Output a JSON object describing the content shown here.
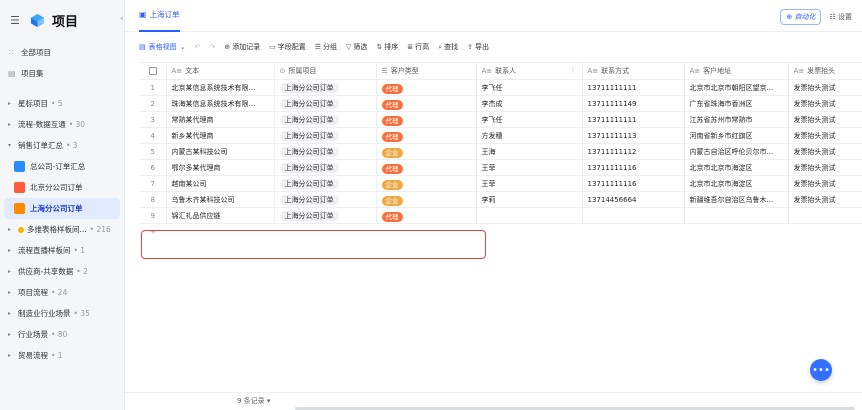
{
  "sidebar": {
    "title": "项目",
    "collapse": "‹",
    "items": [
      {
        "label": "全部项目",
        "count": ""
      },
      {
        "label": "项目集",
        "count": ""
      },
      {
        "label": "星标项目",
        "count": "• 5"
      },
      {
        "label": "流程-数据互通",
        "count": "• 30"
      },
      {
        "label": "销售订单汇总",
        "count": "• 3"
      },
      {
        "label": "总公司-订单汇总",
        "count": ""
      },
      {
        "label": "北京分公司订单",
        "count": ""
      },
      {
        "label": "上海分公司订单",
        "count": ""
      },
      {
        "label": "多维表格样板间...",
        "count": "• 216"
      },
      {
        "label": "流程直播样板间",
        "count": "• 1"
      },
      {
        "label": "供应商-共享数据",
        "count": "• 2"
      },
      {
        "label": "项目流程",
        "count": "• 24"
      },
      {
        "label": "制造业行业场景",
        "count": "• 35"
      },
      {
        "label": "行业场景",
        "count": "• 80"
      },
      {
        "label": "贸易流程",
        "count": "• 1"
      }
    ]
  },
  "topbar": {
    "tab": "上海订单",
    "auto": "自动化",
    "settings": "设置"
  },
  "toolbar": {
    "view": "表格视图",
    "add": "添加记录",
    "fields": "字段配置",
    "group": "分组",
    "filter": "筛选",
    "sort": "排序",
    "row_height": "行高",
    "search": "查找",
    "export": "导出"
  },
  "columns": [
    "文本",
    "所属项目",
    "客户类型",
    "联系人",
    "联系方式",
    "客户地址",
    "发票抬头"
  ],
  "rows": [
    {
      "no": "1",
      "text": "北京某信息系统技术有限...",
      "proj": "上海分公司订单",
      "type": "代理",
      "contact": "李飞任",
      "phone": "13711111111",
      "addr": "北京市北京市朝阳区望京...",
      "invoice": "发票抬头测试"
    },
    {
      "no": "2",
      "text": "珠海某信息系统技术有限...",
      "proj": "上海分公司订单",
      "type": "代理",
      "contact": "李杰成",
      "phone": "13711111149",
      "addr": "广东省珠海市香洲区",
      "invoice": "发票抬头测试"
    },
    {
      "no": "3",
      "text": "常熟某代理商",
      "proj": "上海分公司订单",
      "type": "代理",
      "contact": "李飞任",
      "phone": "13711111111",
      "addr": "江苏省苏州市常熟市",
      "invoice": "发票抬头测试"
    },
    {
      "no": "4",
      "text": "新乡某代理商",
      "proj": "上海分公司订单",
      "type": "代理",
      "contact": "方发穗",
      "phone": "13711111113",
      "addr": "河南省新乡市红旗区",
      "invoice": "发票抬头测试"
    },
    {
      "no": "5",
      "text": "内蒙古某科技公司",
      "proj": "上海分公司订单",
      "type": "企业",
      "contact": "王海",
      "phone": "13711111112",
      "addr": "内蒙古自治区呼伦贝尔市...",
      "invoice": "发票抬头测试"
    },
    {
      "no": "6",
      "text": "鄂尔多某代理商",
      "proj": "上海分公司订单",
      "type": "代理",
      "contact": "王菲",
      "phone": "13711111116",
      "addr": "北京市北京市海淀区",
      "invoice": "发票抬头测试"
    },
    {
      "no": "7",
      "text": "越南某公司",
      "proj": "上海分公司订单",
      "type": "企业",
      "contact": "王菲",
      "phone": "13711111116",
      "addr": "北京市北京市海淀区",
      "invoice": "发票抬头测试"
    },
    {
      "no": "8",
      "text": "乌鲁木齐某科技公司",
      "proj": "上海分公司订单",
      "type": "企业",
      "contact": "李莉",
      "phone": "13714456664",
      "addr": "新疆维吾尔自治区乌鲁木...",
      "invoice": "发票抬头测试"
    },
    {
      "no": "9",
      "text": "锦汇礼品供应链",
      "proj": "上海分公司订单",
      "type": "代理",
      "contact": "",
      "phone": "",
      "addr": "",
      "invoice": ""
    }
  ],
  "colors": {
    "代理": "#f5713b",
    "企业": "#f5a742"
  },
  "footer": {
    "record_count": "9 条记录 ▾",
    "fab": "•••"
  }
}
